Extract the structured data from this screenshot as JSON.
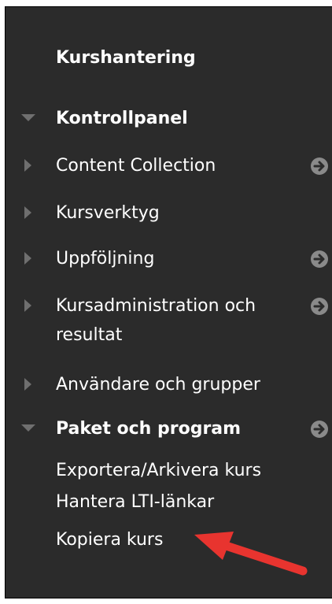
{
  "panel": {
    "title": "Kurshantering",
    "control_panel_label": "Kontrollpanel",
    "items": [
      {
        "label_lines": [
          "Content Collection"
        ],
        "arrow": true
      },
      {
        "label_lines": [
          "Kursverktyg"
        ],
        "arrow": false
      },
      {
        "label_lines": [
          "Uppföljning"
        ],
        "arrow": true
      },
      {
        "label_lines": [
          "Kursadministration och",
          "resultat"
        ],
        "arrow": true
      },
      {
        "label_lines": [
          "Användare och grupper"
        ],
        "arrow": false
      }
    ],
    "packages": {
      "label": "Paket och program",
      "sub_items": [
        "Exportera/Arkivera kurs",
        "Hantera LTI-länkar",
        "Kopiera kurs"
      ]
    }
  },
  "colors": {
    "panel_bg": "#2b2b2b",
    "text": "#ffffff",
    "triangle": "#6f6f6f",
    "circle_arrow": "#8a8a8a",
    "annotation_arrow": "#e8342f"
  },
  "icons": {
    "collapsed": "triangle-right-icon",
    "expanded": "triangle-down-icon",
    "go": "circle-arrow-right-icon",
    "annotation": "red-pointer-arrow"
  }
}
